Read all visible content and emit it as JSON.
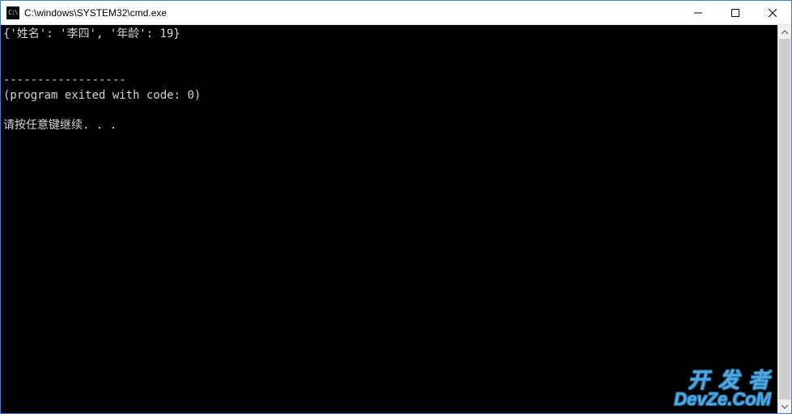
{
  "window": {
    "title": "C:\\windows\\SYSTEM32\\cmd.exe",
    "icon_label": "C:\\"
  },
  "terminal": {
    "lines": [
      "{'姓名': '李四', '年龄': 19}",
      "",
      "",
      "------------------",
      "(program exited with code: 0)",
      "",
      "请按任意键继续. . ."
    ]
  },
  "watermark": {
    "line1": "开 发 者",
    "line2": "DevZe.CoM"
  }
}
